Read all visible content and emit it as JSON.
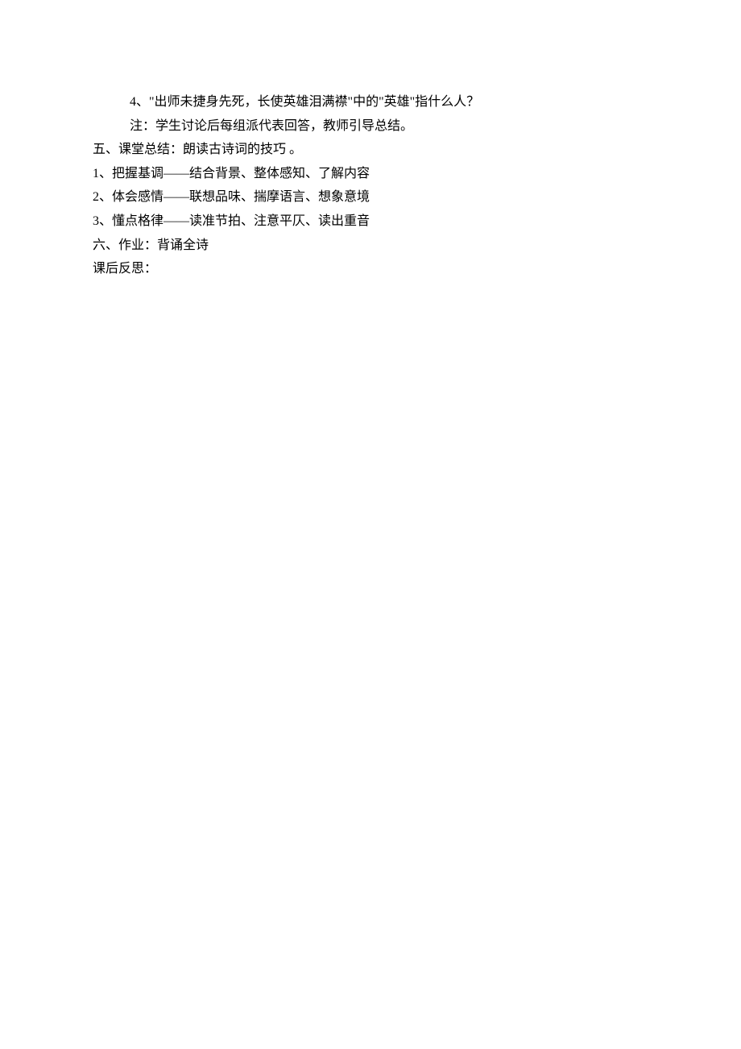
{
  "lines": [
    {
      "text": "4、\"出师未捷身先死，长使英雄泪满襟\"中的\"英雄\"指什么人？",
      "indent": "indent-1"
    },
    {
      "text": "注：学生讨论后每组派代表回答，教师引导总结。",
      "indent": "indent-1"
    },
    {
      "text": "五、课堂总结：朗读古诗词的技巧 。",
      "indent": "indent-0"
    },
    {
      "text": "1、把握基调——结合背景、整体感知、了解内容",
      "indent": "indent-0"
    },
    {
      "text": "2、体会感情——联想品味、揣摩语言、想象意境",
      "indent": "indent-0"
    },
    {
      "text": "3、懂点格律——读准节拍、注意平仄、读出重音",
      "indent": "indent-0"
    },
    {
      "text": "六、作业：背诵全诗",
      "indent": "indent-0"
    },
    {
      "text": "课后反思：",
      "indent": "indent-0"
    }
  ]
}
